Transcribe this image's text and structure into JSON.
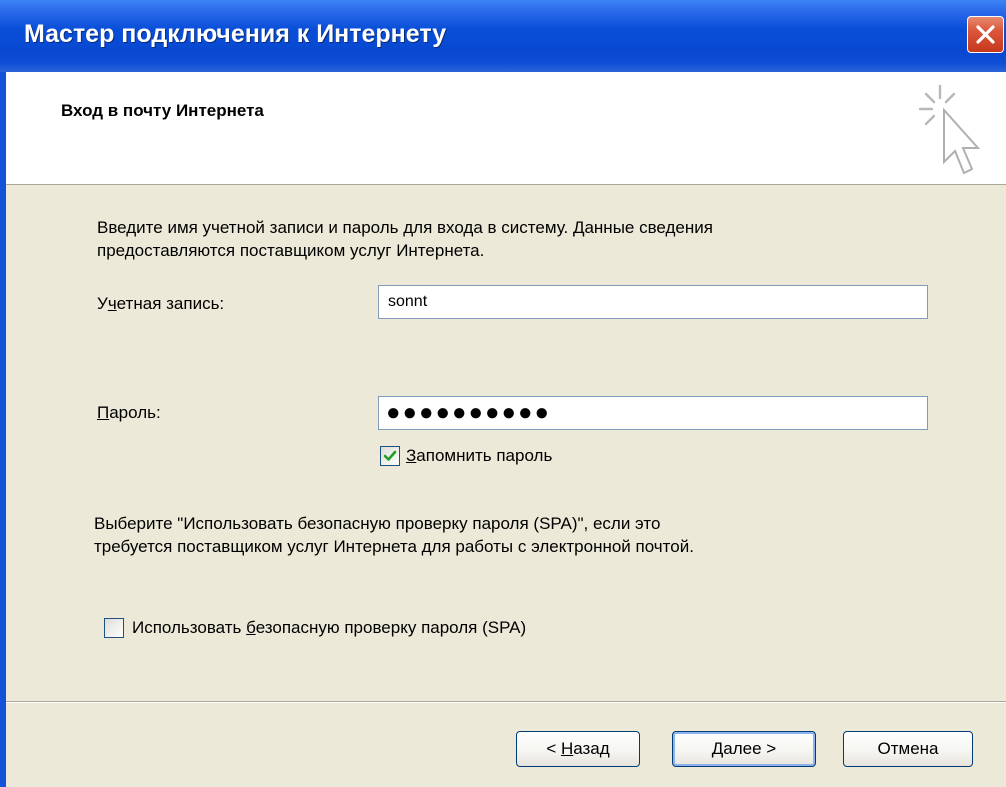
{
  "window": {
    "title": "Мастер подключения к Интернету"
  },
  "header": {
    "heading": "Вход в почту Интернета"
  },
  "content": {
    "intro_line1": "Введите имя учетной записи и пароль для входа в систему. Данные сведения",
    "intro_line2": "предоставляются поставщиком услуг Интернета.",
    "account_label_pre": "У",
    "account_label_ul": "ч",
    "account_label_post": "етная запись:",
    "account_value": "sonnt",
    "password_label_ul": "П",
    "password_label_post": "ароль:",
    "password_mask": "●●●●●●●●●●",
    "remember_label_ul": "З",
    "remember_label_post": "апомнить пароль",
    "remember_checked": true,
    "spa_text_line1": "Выберите \"Использовать безопасную проверку пароля (SPA)\", если это",
    "spa_text_line2": "требуется поставщиком услуг Интернета для работы с электронной почтой.",
    "spa_label_pre": "Использовать ",
    "spa_label_ul": "б",
    "spa_label_post": "езопасную проверку пароля (SPA)",
    "spa_checked": false
  },
  "buttons": {
    "back_pre": "< ",
    "back_ul": "Н",
    "back_post": "азад",
    "next_ul": "Д",
    "next_post": "алее >",
    "cancel": "Отмена"
  },
  "colors": {
    "titlebar": "#0a4fd9",
    "dialog_bg": "#ece9d8",
    "checkmark": "#21a121"
  }
}
